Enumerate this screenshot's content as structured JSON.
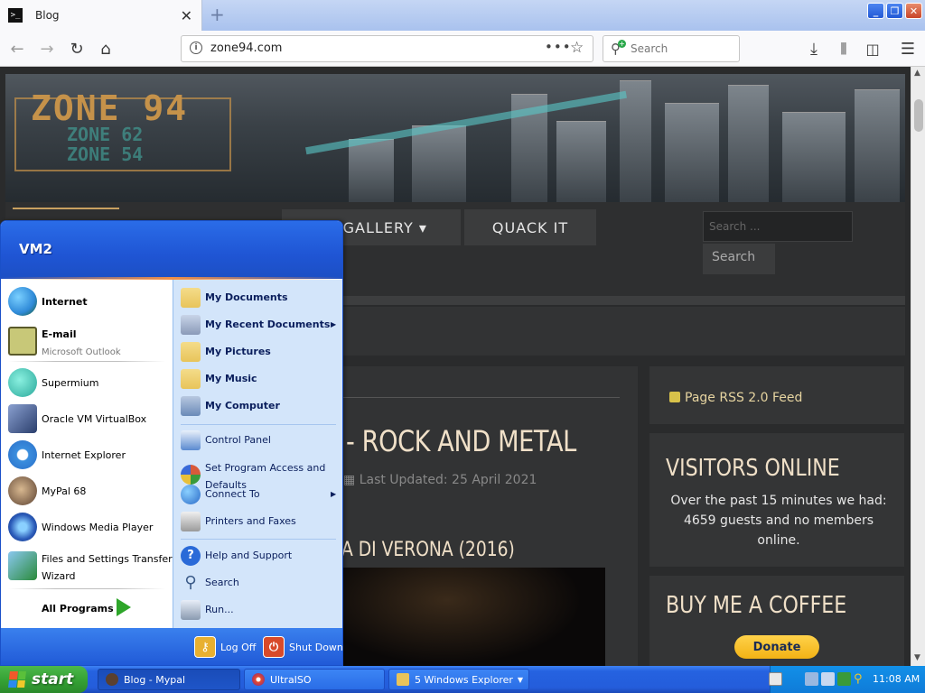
{
  "browser": {
    "tab_title": "Blog",
    "new_tab": "+",
    "url": "zone94.com",
    "url_actions": "•••",
    "search_placeholder": "Search"
  },
  "site": {
    "logo": "ZONE 94",
    "logo_sub_1": "ZONE 62",
    "logo_sub_2": "ZONE 54",
    "menu": [
      "GE GALLERY ▾",
      "QUACK IT"
    ],
    "search_placeholder": "Search ...",
    "search_button": "Search",
    "article_title": "- ROCK AND METAL",
    "article_date": "Last Updated: 25 April 2021",
    "article_subtitle": "A DI VERONA (2016)",
    "rss_label": "Page RSS 2.0 Feed",
    "visitors_title": "VISITORS ONLINE",
    "visitors_text": "Over the past 15 minutes we had: 4659 guests and no members online.",
    "coffee_title": "BUY ME A COFFEE",
    "donate_label": "Donate"
  },
  "start_menu": {
    "user": "VM2",
    "pinned": [
      {
        "label": "Internet",
        "color": "#2f8ad8"
      },
      {
        "label": "E-mail",
        "sub": "Microsoft Outlook",
        "color": "#c8c878"
      }
    ],
    "recent": [
      {
        "label": "Supermium",
        "color": "#2aa89a"
      },
      {
        "label": "Oracle VM VirtualBox",
        "color": "#4a5e8c"
      },
      {
        "label": "Internet Explorer",
        "color": "#3a8ede"
      },
      {
        "label": "MyPal 68",
        "color": "#5a4030"
      },
      {
        "label": "Windows Media Player",
        "color": "#2a5ab8"
      },
      {
        "label": "Files and Settings Transfer",
        "label2": "Wizard",
        "color": "#4a88c8"
      }
    ],
    "all_programs": "All Programs",
    "places": [
      {
        "label": "My Documents",
        "bold": true,
        "color": "#e8c45a"
      },
      {
        "label": "My Recent Documents",
        "bold": true,
        "color": "#8a9ab8",
        "arrow": "▶"
      },
      {
        "label": "My Pictures",
        "bold": true,
        "color": "#e8c45a"
      },
      {
        "label": "My Music",
        "bold": true,
        "color": "#e8c45a"
      },
      {
        "label": "My Computer",
        "bold": true,
        "color": "#6a8ab8"
      }
    ],
    "settings": [
      {
        "label": "Control Panel",
        "color": "#5a8ad0"
      },
      {
        "label": "Set Program Access and",
        "label2": "Defaults",
        "color": "#d85a3a"
      },
      {
        "label": "Connect To",
        "color": "#3a8ad8",
        "arrow": "▶"
      },
      {
        "label": "Printers and Faxes",
        "color": "#9a9a9a"
      }
    ],
    "help": [
      {
        "label": "Help and Support",
        "color": "#2a6ad8"
      },
      {
        "label": "Search",
        "color": "#6a8aa8"
      },
      {
        "label": "Run...",
        "color": "#8a9ab0"
      }
    ],
    "log_off": "Log Off",
    "shut_down": "Shut Down"
  },
  "taskbar": {
    "start": "start",
    "tasks": [
      {
        "label": "Blog - Mypal",
        "color": "#5a4030"
      },
      {
        "label": "UltraISO",
        "color": "#e84a2a"
      },
      {
        "label": "5 Windows Explorer",
        "color": "#e8c45a"
      }
    ],
    "clock": "11:08 AM"
  },
  "colors": {
    "accent_gold": "#c8a060",
    "xp_blue": "#245ddb",
    "start_green": "#36a336"
  }
}
